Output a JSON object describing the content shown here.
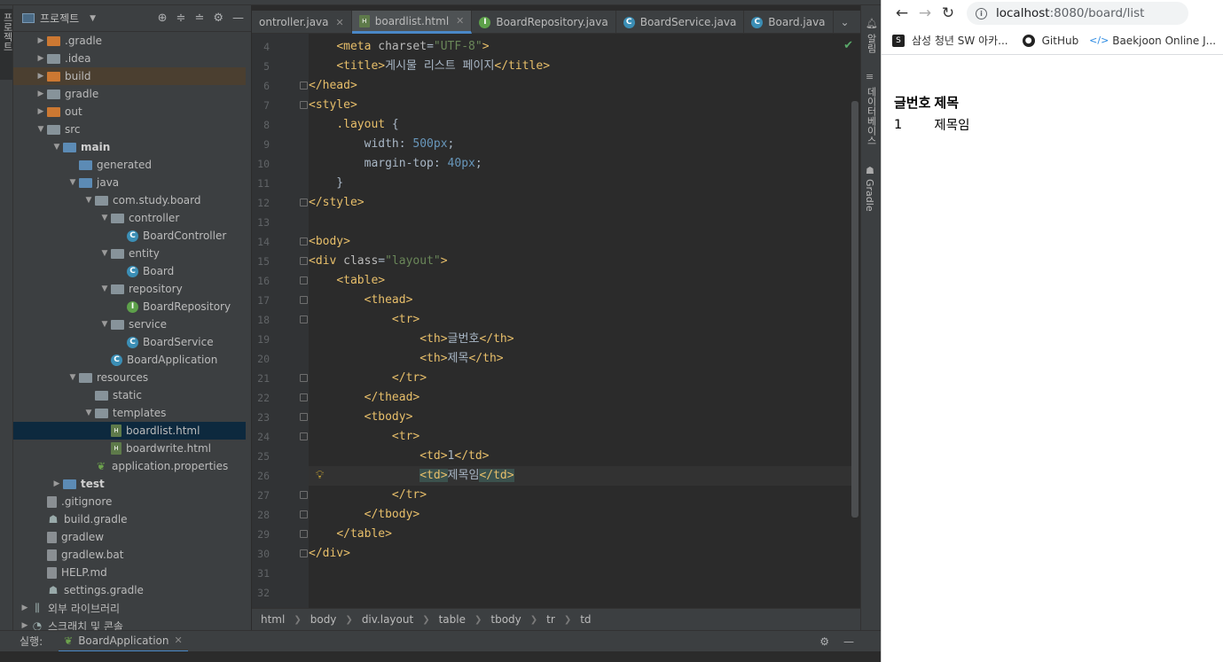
{
  "ide": {
    "left_tab_label": "프로젝트",
    "project_panel": {
      "title": "프로젝트",
      "tree": [
        {
          "label": ".gradle",
          "icon": "folder-orange-icon",
          "indent": 1,
          "arrow": "collapsed",
          "bold": false
        },
        {
          "label": ".idea",
          "icon": "folder-icon",
          "indent": 1,
          "arrow": "collapsed",
          "bold": false
        },
        {
          "label": "build",
          "icon": "folder-orange-icon",
          "indent": 1,
          "arrow": "collapsed",
          "bold": false,
          "highlight": true
        },
        {
          "label": "gradle",
          "icon": "folder-icon",
          "indent": 1,
          "arrow": "collapsed",
          "bold": false
        },
        {
          "label": "out",
          "icon": "folder-orange-icon",
          "indent": 1,
          "arrow": "collapsed",
          "bold": false
        },
        {
          "label": "src",
          "icon": "folder-icon",
          "indent": 1,
          "arrow": "expanded",
          "bold": false
        },
        {
          "label": "main",
          "icon": "folder-blue-icon",
          "indent": 2,
          "arrow": "expanded",
          "bold": true
        },
        {
          "label": "generated",
          "icon": "folder-blue-icon",
          "indent": 3,
          "arrow": "none",
          "bold": false
        },
        {
          "label": "java",
          "icon": "folder-blue-icon",
          "indent": 3,
          "arrow": "expanded",
          "bold": false
        },
        {
          "label": "com.study.board",
          "icon": "folder-icon",
          "indent": 4,
          "arrow": "expanded",
          "bold": false
        },
        {
          "label": "controller",
          "icon": "folder-icon",
          "indent": 5,
          "arrow": "expanded",
          "bold": false
        },
        {
          "label": "BoardController",
          "icon": "class-icon",
          "indent": 6,
          "arrow": "none",
          "bold": false
        },
        {
          "label": "entity",
          "icon": "folder-icon",
          "indent": 5,
          "arrow": "expanded",
          "bold": false
        },
        {
          "label": "Board",
          "icon": "class-icon",
          "indent": 6,
          "arrow": "none",
          "bold": false
        },
        {
          "label": "repository",
          "icon": "folder-icon",
          "indent": 5,
          "arrow": "expanded",
          "bold": false
        },
        {
          "label": "BoardRepository",
          "icon": "interface-icon",
          "indent": 6,
          "arrow": "none",
          "bold": false
        },
        {
          "label": "service",
          "icon": "folder-icon",
          "indent": 5,
          "arrow": "expanded",
          "bold": false
        },
        {
          "label": "BoardService",
          "icon": "class-icon",
          "indent": 6,
          "arrow": "none",
          "bold": false
        },
        {
          "label": "BoardApplication",
          "icon": "class-icon",
          "indent": 5,
          "arrow": "none",
          "bold": false
        },
        {
          "label": "resources",
          "icon": "folder-icon",
          "indent": 3,
          "arrow": "expanded",
          "bold": false
        },
        {
          "label": "static",
          "icon": "folder-icon",
          "indent": 4,
          "arrow": "none",
          "bold": false
        },
        {
          "label": "templates",
          "icon": "folder-icon",
          "indent": 4,
          "arrow": "expanded",
          "bold": false
        },
        {
          "label": "boardlist.html",
          "icon": "html-icon",
          "indent": 5,
          "arrow": "none",
          "bold": false,
          "selected": true
        },
        {
          "label": "boardwrite.html",
          "icon": "html-icon",
          "indent": 5,
          "arrow": "none",
          "bold": false
        },
        {
          "label": "application.properties",
          "icon": "leaf-icon",
          "indent": 4,
          "arrow": "none",
          "bold": false
        },
        {
          "label": "test",
          "icon": "folder-blue-icon",
          "indent": 2,
          "arrow": "collapsed",
          "bold": true
        },
        {
          "label": ".gitignore",
          "icon": "file-icon",
          "indent": 1,
          "arrow": "none",
          "bold": false
        },
        {
          "label": "build.gradle",
          "icon": "gradle-icon",
          "indent": 1,
          "arrow": "none",
          "bold": false
        },
        {
          "label": "gradlew",
          "icon": "file-icon",
          "indent": 1,
          "arrow": "none",
          "bold": false
        },
        {
          "label": "gradlew.bat",
          "icon": "file-icon",
          "indent": 1,
          "arrow": "none",
          "bold": false
        },
        {
          "label": "HELP.md",
          "icon": "file-icon",
          "indent": 1,
          "arrow": "none",
          "bold": false
        },
        {
          "label": "settings.gradle",
          "icon": "gradle-icon",
          "indent": 1,
          "arrow": "none",
          "bold": false
        },
        {
          "label": "외부 라이브러리",
          "icon": "library-icon",
          "indent": 0,
          "arrow": "collapsed",
          "bold": false
        },
        {
          "label": "스크래치 및 콘솔",
          "icon": "scratch-icon",
          "indent": 0,
          "arrow": "collapsed",
          "bold": false
        }
      ]
    },
    "tabs": [
      {
        "label": "ontroller.java",
        "icon": "class-icon",
        "active": false,
        "close": true
      },
      {
        "label": "boardlist.html",
        "icon": "html-icon",
        "active": true,
        "close": true
      },
      {
        "label": "BoardRepository.java",
        "icon": "interface-icon",
        "active": false,
        "close": false
      },
      {
        "label": "BoardService.java",
        "icon": "class-icon",
        "active": false,
        "close": false
      },
      {
        "label": "Board.java",
        "icon": "class-icon",
        "active": false,
        "close": false
      }
    ],
    "code_lines": [
      {
        "n": "4",
        "html": "    <span class='tag'>&lt;meta </span><span class='attr'>charset</span>=<span class='str'>\"UTF-8\"</span><span class='tag'>&gt;</span>"
      },
      {
        "n": "5",
        "html": "    <span class='tag'>&lt;title&gt;</span>게시물 리스트 페이지<span class='tag'>&lt;/title&gt;</span>"
      },
      {
        "n": "6",
        "html": "<span class='tag'>&lt;/head&gt;</span>"
      },
      {
        "n": "7",
        "html": "<span class='tag'>&lt;style&gt;</span>"
      },
      {
        "n": "8",
        "html": "    <span class='sel'>.layout</span> {"
      },
      {
        "n": "9",
        "html": "        width: <span class='num'>500px</span>;"
      },
      {
        "n": "10",
        "html": "        margin-top: <span class='num'>40px</span>;"
      },
      {
        "n": "11",
        "html": "    }"
      },
      {
        "n": "12",
        "html": "<span class='tag'>&lt;/style&gt;</span>"
      },
      {
        "n": "13",
        "html": ""
      },
      {
        "n": "14",
        "html": "<span class='tag'>&lt;body&gt;</span>"
      },
      {
        "n": "15",
        "html": "<span class='tag'>&lt;div </span><span class='attr'>class</span>=<span class='str'>\"layout\"</span><span class='tag'>&gt;</span>"
      },
      {
        "n": "16",
        "html": "    <span class='tag'>&lt;table&gt;</span>"
      },
      {
        "n": "17",
        "html": "        <span class='tag'>&lt;thead&gt;</span>"
      },
      {
        "n": "18",
        "html": "            <span class='tag'>&lt;tr&gt;</span>"
      },
      {
        "n": "19",
        "html": "                <span class='tag'>&lt;th&gt;</span>글번호<span class='tag'>&lt;/th&gt;</span>"
      },
      {
        "n": "20",
        "html": "                <span class='tag'>&lt;th&gt;</span>제목<span class='tag'>&lt;/th&gt;</span>"
      },
      {
        "n": "21",
        "html": "            <span class='tag'>&lt;/tr&gt;</span>"
      },
      {
        "n": "22",
        "html": "        <span class='tag'>&lt;/thead&gt;</span>"
      },
      {
        "n": "23",
        "html": "        <span class='tag'>&lt;tbody&gt;</span>"
      },
      {
        "n": "24",
        "html": "            <span class='tag'>&lt;tr&gt;</span>"
      },
      {
        "n": "25",
        "html": "                <span class='tag'>&lt;td&gt;</span>1<span class='tag'>&lt;/td&gt;</span>"
      },
      {
        "n": "26",
        "html": "                <span class='tag bracket-hl'>&lt;td&gt;</span>제목임<span class='tag bracket-hl'>&lt;/td&gt;</span>",
        "current": true
      },
      {
        "n": "27",
        "html": "            <span class='tag'>&lt;/tr&gt;</span>"
      },
      {
        "n": "28",
        "html": "        <span class='tag'>&lt;/tbody&gt;</span>"
      },
      {
        "n": "29",
        "html": "    <span class='tag'>&lt;/table&gt;</span>"
      },
      {
        "n": "30",
        "html": "<span class='tag'>&lt;/div&gt;</span>"
      },
      {
        "n": "31",
        "html": ""
      },
      {
        "n": "32",
        "html": ""
      }
    ],
    "breadcrumb": [
      "html",
      "body",
      "div.layout",
      "table",
      "tbody",
      "tr",
      "td"
    ],
    "right_tools": [
      "알림",
      "데이터베이스",
      "Gradle"
    ],
    "run_bar": {
      "label": "실행:",
      "tab": "BoardApplication"
    }
  },
  "browser": {
    "url_host": "localhost",
    "url_path": ":8080/board/list",
    "bookmarks": [
      {
        "label": "삼성 청년 SW 아카...",
        "icon": "ssafy-icon"
      },
      {
        "label": "GitHub",
        "icon": "github-icon"
      },
      {
        "label": "Baekjoon Online J...",
        "icon": "baekjoon-icon"
      }
    ],
    "table": {
      "headers": [
        "글번호",
        "제목"
      ],
      "rows": [
        [
          "1",
          "제목임"
        ]
      ]
    }
  }
}
